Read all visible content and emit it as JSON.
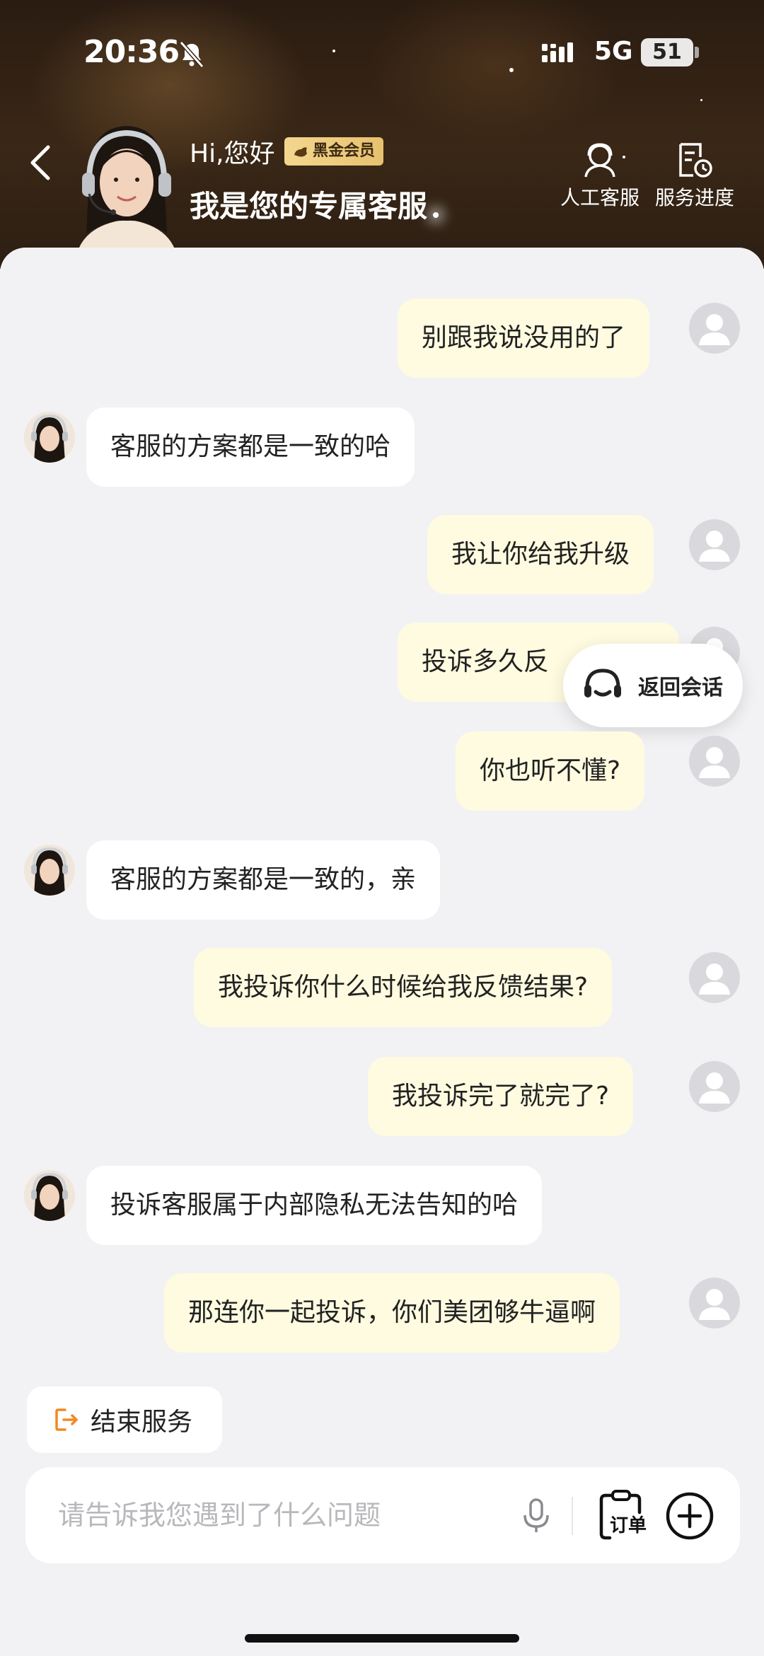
{
  "status_bar": {
    "time": "20:36",
    "network": "5G",
    "battery": "51"
  },
  "header": {
    "greeting": "Hi,您好",
    "member_badge": "黑金会员",
    "subtitle": "我是您的专属客服",
    "actions": [
      {
        "label": "人工客服",
        "icon": "agent-headset-icon"
      },
      {
        "label": "服务进度",
        "icon": "service-progress-icon"
      }
    ]
  },
  "messages": [
    {
      "from": "user",
      "text": "别跟我说没用的了"
    },
    {
      "from": "bot",
      "text": "客服的方案都是一致的哈"
    },
    {
      "from": "user",
      "text": "我让你给我升级"
    },
    {
      "from": "user",
      "text": "投诉多久反"
    },
    {
      "from": "user",
      "text": "你也听不懂?"
    },
    {
      "from": "bot",
      "text": "客服的方案都是一致的，亲"
    },
    {
      "from": "user",
      "text": "我投诉你什么时候给我反馈结果?"
    },
    {
      "from": "user",
      "text": "我投诉完了就完了?"
    },
    {
      "from": "bot",
      "text": "投诉客服属于内部隐私无法告知的哈"
    },
    {
      "from": "user",
      "text": "那连你一起投诉，你们美团够牛逼啊"
    }
  ],
  "float_button": {
    "label": "返回会话"
  },
  "end_service": {
    "label": "结束服务"
  },
  "input": {
    "placeholder": "请告诉我您遇到了什么问题",
    "value": "",
    "order_label": "订单"
  },
  "colors": {
    "user_bubble": "#fffbe0",
    "bot_bubble": "#ffffff",
    "accent_orange": "#f08a24",
    "badge_gold": "#e8c06f"
  }
}
